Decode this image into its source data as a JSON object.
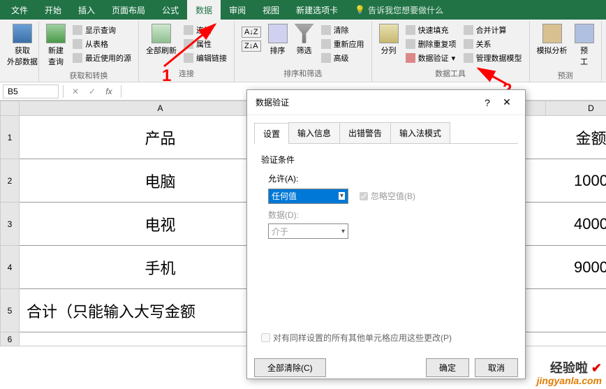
{
  "tabs": [
    "文件",
    "开始",
    "插入",
    "页面布局",
    "公式",
    "数据",
    "审阅",
    "视图",
    "新建选项卡"
  ],
  "active_tab": "数据",
  "tell_me": "告诉我您想要做什么",
  "ribbon": {
    "g1": {
      "btn": "获取\n外部数据"
    },
    "g2": {
      "btn": "新建\n查询",
      "i1": "显示查询",
      "i2": "从表格",
      "i3": "最近使用的源",
      "label": "获取和转换"
    },
    "g3": {
      "btn": "全部刷新",
      "i1": "连接",
      "i2": "属性",
      "i3": "编辑链接",
      "label": "连接"
    },
    "g4": {
      "b1": "排序",
      "b2": "筛选",
      "i1": "清除",
      "i2": "重新应用",
      "i3": "高级",
      "label": "排序和筛选"
    },
    "g5": {
      "btn": "分列",
      "i1": "快速填充",
      "i2": "删除重复项",
      "i3": "数据验证",
      "i4": "合并计算",
      "i5": "关系",
      "i6": "管理数据模型",
      "label": "数据工具"
    },
    "g6": {
      "btn": "模拟分析",
      "b2": "预\n工",
      "label": "预测"
    }
  },
  "namebox": "B5",
  "cols": {
    "A": "A",
    "D": "D"
  },
  "rows": [
    "1",
    "2",
    "3",
    "4",
    "5",
    "6"
  ],
  "cells": {
    "A1": "产品",
    "D1": "金额",
    "A2": "电脑",
    "D2": "1000",
    "A3": "电视",
    "D3": "4000",
    "A4": "手机",
    "D4": "9000",
    "A5": "合计（只能输入大写金额",
    "D5": ""
  },
  "ann": {
    "one": "1",
    "two": "2"
  },
  "dialog": {
    "title": "数据验证",
    "tabs": [
      "设置",
      "输入信息",
      "出错警告",
      "输入法模式"
    ],
    "cond_label": "验证条件",
    "allow_label": "允许(A):",
    "allow_value": "任何值",
    "ignore_blank": "忽略空值(B)",
    "data_label": "数据(D):",
    "data_value": "介于",
    "apply_all": "对有同样设置的所有其他单元格应用这些更改(P)",
    "clear_all": "全部清除(C)",
    "ok": "确定",
    "cancel": "取消"
  },
  "watermark": {
    "zh": "经验啦",
    "en": "jingyanla.com"
  }
}
